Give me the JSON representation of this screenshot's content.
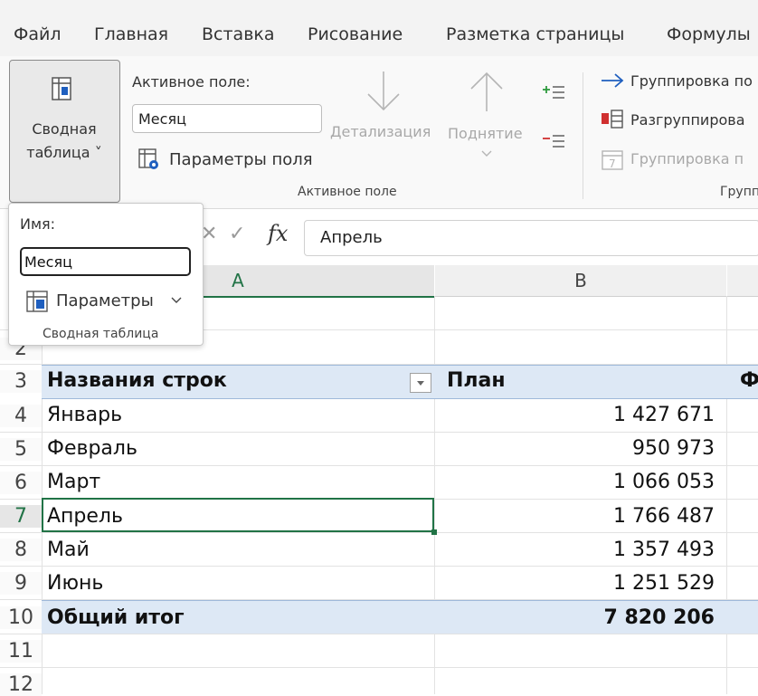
{
  "menu": {
    "tabs": [
      "Файл",
      "Главная",
      "Вставка",
      "Рисование",
      "Разметка страницы",
      "Формулы"
    ]
  },
  "ribbon": {
    "pivot_button": {
      "line1": "Сводная",
      "line2": "таблица ˅"
    },
    "active_field": {
      "label": "Активное поле:",
      "value": "Месяц",
      "field_settings": "Параметры поля",
      "drill_down": "Детализация",
      "drill_up": "Поднятие",
      "group_label": "Активное поле"
    },
    "group": {
      "group_selection": "Группировка по",
      "ungroup": "Разгруппирова",
      "group_field": "Группировка п",
      "group_label": "Групп"
    }
  },
  "popup": {
    "name_label": "Имя:",
    "name_value": "Месяц",
    "options_label": "Параметры",
    "group_label": "Сводная таблица"
  },
  "formula_bar": {
    "value": "Апрель"
  },
  "grid": {
    "columns": [
      "A",
      "B"
    ],
    "row_numbers": [
      "2",
      "3",
      "4",
      "5",
      "6",
      "7",
      "8",
      "9",
      "10",
      "11",
      "12"
    ],
    "header": {
      "a": "Названия строк",
      "b": "План",
      "c": "Ф"
    },
    "rows": [
      {
        "label": "Январь",
        "value": "1 427 671"
      },
      {
        "label": "Февраль",
        "value": "950 973"
      },
      {
        "label": "Март",
        "value": "1 066 053"
      },
      {
        "label": "Апрель",
        "value": "1 766 487"
      },
      {
        "label": "Май",
        "value": "1 357 493"
      },
      {
        "label": "Июнь",
        "value": "1 251 529"
      }
    ],
    "total": {
      "label": "Общий итог",
      "value": "7 820 206"
    }
  },
  "colors": {
    "accent": "#217346",
    "pivot_header_fill": "#dde8f5",
    "link_blue": "#1f5fbf"
  }
}
